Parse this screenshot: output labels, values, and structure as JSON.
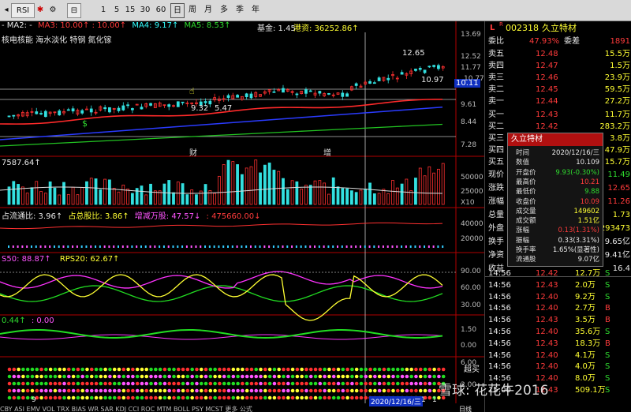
{
  "toolbar": {
    "indicator_select": "RSI",
    "period_buttons": [
      "1",
      "5",
      "15",
      "30",
      "60",
      "日",
      "周",
      "月",
      "多",
      "季",
      "年"
    ]
  },
  "main_chart": {
    "ma_legend": {
      "ma2": "MA2: -",
      "ma3": "MA3: 10.00↑",
      "ma3b": ": 10.00↑",
      "ma4": "MA4: 9.17↑",
      "ma5": "MA5: 8.53↑"
    },
    "fund_label": "基金: 1.45",
    "hk_label": "港资: 36252.86↑",
    "concepts": "核电核能 海水淡化 特钢 氮化镓",
    "price_high": "12.65",
    "price_low1": "9.32",
    "price_low2": "5.47",
    "price_cur": "10.97",
    "price_cur_box": "10.11",
    "event_cai": "财",
    "event_zeng": "增",
    "axis_labels": [
      "13.69",
      "12.52",
      "11.77",
      "10.77",
      "9.61",
      "8.44",
      "7.28"
    ],
    "colors": {
      "ma_red": "#ff2a2a",
      "ma_blue": "#2a3bff",
      "ma_green": "#22c422"
    }
  },
  "volume": {
    "label": "7587.64↑",
    "axis_labels": [
      "50000",
      "25000",
      "X10"
    ]
  },
  "liudong": {
    "label1": "占流通比: 3.96↑",
    "label2": "占总股比: 3.86↑",
    "label3": "增减万股: 47.57↓",
    "label4": ": 475660.00↓",
    "axis_labels": [
      "40000",
      "20000"
    ]
  },
  "rps": {
    "label1": "S50: 88.87↑",
    "label2": "RPS20: 62.67↑",
    "axis_labels": [
      "90.00",
      "60.00",
      "30.00"
    ]
  },
  "osc": {
    "label1": "0.44↑",
    "label2": ": 0.00",
    "axis_labels": [
      "1.50",
      "0.00"
    ]
  },
  "dots": {
    "axis_labels": [
      "6.00",
      "2.00"
    ],
    "side_label": "超买"
  },
  "bottom_bar": {
    "date": "2020/12/16/三",
    "x_marks": [
      "9",
      "1",
      "1"
    ],
    "nav": "CBY ASI EMV VOL TRX BIAS WR SAR KDJ CCI ROC MTM BOLL PSY MCST 更多 公式",
    "right_label": "日线"
  },
  "stock": {
    "code": "002318",
    "name": "久立特材",
    "weibi_label": "委比",
    "weibi_val": "47.93%",
    "weicha_label": "委差",
    "weicha_val": "1891",
    "asks": [
      {
        "label": "卖五",
        "price": "12.48",
        "vol": "15.5万"
      },
      {
        "label": "卖四",
        "price": "12.47",
        "vol": "1.5万"
      },
      {
        "label": "卖三",
        "price": "12.46",
        "vol": "23.9万"
      },
      {
        "label": "卖二",
        "price": "12.45",
        "vol": "59.5万"
      },
      {
        "label": "卖一",
        "price": "12.44",
        "vol": "27.2万"
      }
    ],
    "bids": [
      {
        "label": "买一",
        "price": "12.43",
        "vol": "11.7万"
      },
      {
        "label": "买二",
        "price": "12.42",
        "vol": "283.2万"
      },
      {
        "label": "买三",
        "price": "",
        "vol": "3.8万"
      },
      {
        "label": "买四",
        "price": "",
        "vol": "47.9万"
      },
      {
        "label": "买五",
        "price": "",
        "vol": "15.7万"
      }
    ],
    "info_rows": [
      {
        "label": "现价",
        "val": "11.49"
      },
      {
        "label": "涨跌",
        "val": "12.65"
      },
      {
        "label": "涨幅",
        "val": "11.26"
      },
      {
        "label": "总量",
        "val": "1.73"
      },
      {
        "label": "外盘",
        "val": "293473"
      },
      {
        "label": "换手",
        "val": "9.65亿"
      },
      {
        "label": "净资",
        "val": "9.41亿"
      },
      {
        "label": "收益",
        "val": "16.4"
      }
    ],
    "ticks": [
      {
        "t": "14:56",
        "p": "12.42",
        "v": "12.7万",
        "s": "S"
      },
      {
        "t": "14:56",
        "p": "12.43",
        "v": "2.0万",
        "s": "S"
      },
      {
        "t": "14:56",
        "p": "12.40",
        "v": "9.2万",
        "s": "S"
      },
      {
        "t": "14:56",
        "p": "12.40",
        "v": "2.7万",
        "s": "B"
      },
      {
        "t": "14:56",
        "p": "12.43",
        "v": "3.5万",
        "s": "B"
      },
      {
        "t": "14:56",
        "p": "12.40",
        "v": "35.6万",
        "s": "S"
      },
      {
        "t": "14:56",
        "p": "12.43",
        "v": "18.3万",
        "s": "B"
      },
      {
        "t": "14:56",
        "p": "12.40",
        "v": "4.1万",
        "s": "S"
      },
      {
        "t": "14:56",
        "p": "12.40",
        "v": "4.0万",
        "s": "S"
      },
      {
        "t": "14:56",
        "p": "12.40",
        "v": "8.0万",
        "s": "S"
      },
      {
        "t": "15:00",
        "p": "12.43",
        "v": "509.1万",
        "s": "S"
      }
    ]
  },
  "popup": {
    "title": "久立特材",
    "rows": [
      {
        "k": "时间",
        "v": "2020/12/16/三"
      },
      {
        "k": "数值",
        "v": "10.109"
      },
      {
        "k": "开盘价",
        "v": "9.93(-0.30%)"
      },
      {
        "k": "最高价",
        "v": "10.21"
      },
      {
        "k": "最低价",
        "v": "9.88"
      },
      {
        "k": "收盘价",
        "v": "10.09"
      },
      {
        "k": "成交量",
        "v": "149602"
      },
      {
        "k": "成交额",
        "v": "1.51亿"
      },
      {
        "k": "涨幅",
        "v": "0.13(1.31%)"
      },
      {
        "k": "振幅",
        "v": "0.33(3.31%)"
      },
      {
        "k": "换手率",
        "v": "1.65%(显著性)"
      },
      {
        "k": "流通股",
        "v": "9.07亿"
      }
    ]
  },
  "watermark": "雪球: 花花牛2016"
}
